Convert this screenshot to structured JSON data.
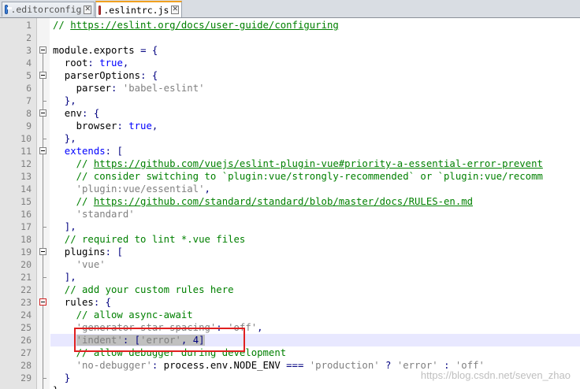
{
  "tabs": [
    {
      "name": ".editorconfig",
      "icon": "file-saved-icon",
      "icon_color": "#3c7fd6",
      "active": false
    },
    {
      "name": ".eslintrc.js",
      "icon": "file-unsaved-icon",
      "icon_color": "#d63c3c",
      "active": true
    }
  ],
  "editor": {
    "line_numbers": [
      "1",
      "2",
      "3",
      "4",
      "5",
      "6",
      "7",
      "8",
      "9",
      "10",
      "11",
      "12",
      "13",
      "14",
      "15",
      "16",
      "17",
      "18",
      "19",
      "20",
      "21",
      "22",
      "23",
      "24",
      "25",
      "26",
      "27",
      "28",
      "29"
    ],
    "lines": [
      [
        [
          "c-com",
          "// "
        ],
        [
          "c-url",
          "https://eslint.org/docs/user-guide/configuring"
        ]
      ],
      [],
      [
        [
          "",
          "module.exports "
        ],
        [
          "c-op",
          "= {"
        ]
      ],
      [
        [
          "",
          "  root"
        ],
        [
          "c-op",
          ": "
        ],
        [
          "c-kw",
          "true"
        ],
        [
          "c-op",
          ","
        ]
      ],
      [
        [
          "",
          "  parserOptions"
        ],
        [
          "c-op",
          ": {"
        ]
      ],
      [
        [
          "",
          "    parser"
        ],
        [
          "c-op",
          ": "
        ],
        [
          "c-str",
          "'babel-eslint'"
        ]
      ],
      [
        [
          "c-op",
          "  },"
        ]
      ],
      [
        [
          "",
          "  env"
        ],
        [
          "c-op",
          ": {"
        ]
      ],
      [
        [
          "",
          "    browser"
        ],
        [
          "c-op",
          ": "
        ],
        [
          "c-kw",
          "true"
        ],
        [
          "c-op",
          ","
        ]
      ],
      [
        [
          "c-op",
          "  },"
        ]
      ],
      [
        [
          "c-kw",
          "  extends"
        ],
        [
          "c-op",
          ": ["
        ]
      ],
      [
        [
          "c-com",
          "    // "
        ],
        [
          "c-url",
          "https://github.com/vuejs/eslint-plugin-vue#priority-a-essential-error-prevent"
        ]
      ],
      [
        [
          "c-com",
          "    // consider switching to `plugin:vue/strongly-recommended` or `plugin:vue/recomm"
        ]
      ],
      [
        [
          "c-str",
          "    'plugin:vue/essential'"
        ],
        [
          "c-op",
          ","
        ]
      ],
      [
        [
          "c-com",
          "    // "
        ],
        [
          "c-url",
          "https://github.com/standard/standard/blob/master/docs/RULES-en.md"
        ]
      ],
      [
        [
          "c-str",
          "    'standard'"
        ]
      ],
      [
        [
          "c-op",
          "  ],"
        ]
      ],
      [
        [
          "c-com",
          "  // required to lint *.vue files"
        ]
      ],
      [
        [
          "",
          "  plugins"
        ],
        [
          "c-op",
          ": ["
        ]
      ],
      [
        [
          "c-str",
          "    'vue'"
        ]
      ],
      [
        [
          "c-op",
          "  ],"
        ]
      ],
      [
        [
          "c-com",
          "  // add your custom rules here"
        ]
      ],
      [
        [
          "",
          "  rules"
        ],
        [
          "c-op",
          ": {"
        ]
      ],
      [
        [
          "c-com",
          "    // allow async-await"
        ]
      ],
      [
        [
          "c-str",
          "    'generator-star-spacing'"
        ],
        [
          "c-op",
          ": "
        ],
        [
          "c-str",
          "'off'"
        ],
        [
          "c-op",
          ","
        ]
      ],
      [
        [
          "",
          "    "
        ],
        [
          "c-str c-sel",
          "'indent'"
        ],
        [
          "c-op c-sel",
          ": ["
        ],
        [
          "c-str c-sel",
          "'error'"
        ],
        [
          "c-op c-sel",
          ", "
        ],
        [
          "c-op c-sel",
          "4"
        ],
        [
          "c-op c-sel",
          "]"
        ]
      ],
      [
        [
          "c-com",
          "    // allow debugger during development"
        ]
      ],
      [
        [
          "c-str",
          "    'no-debugger'"
        ],
        [
          "c-op",
          ": "
        ],
        [
          "",
          "process.env.NODE_ENV "
        ],
        [
          "c-op",
          "=== "
        ],
        [
          "c-str",
          "'production' "
        ],
        [
          "c-op",
          "? "
        ],
        [
          "c-str",
          "'error' "
        ],
        [
          "c-op",
          ": "
        ],
        [
          "c-str",
          "'off'"
        ]
      ],
      [
        [
          "c-op",
          "  }"
        ]
      ]
    ],
    "last_partial": "}"
  },
  "watermark": "https://blog.csdn.net/seven_zhao"
}
